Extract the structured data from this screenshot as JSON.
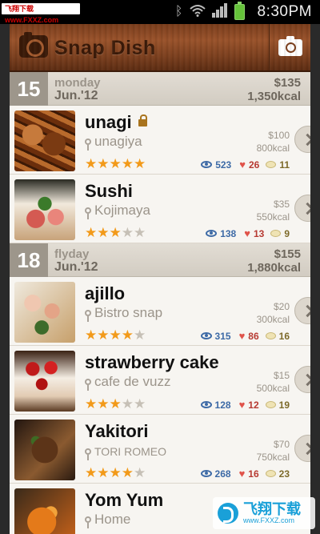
{
  "status_bar": {
    "watermark": "飞翔下载 www.FXXZ.com",
    "time": "8:30PM",
    "icons": [
      "bluetooth-icon",
      "wifi-icon",
      "signal-icon",
      "battery-icon"
    ]
  },
  "header": {
    "app_name": "Snap Dish",
    "camera_button": "camera-icon"
  },
  "days": [
    {
      "num": "15",
      "weekday": "monday",
      "date": "Jun.'12",
      "total_price": "$135",
      "total_kcal": "1,350kcal",
      "items": [
        {
          "title": "unagi",
          "locked": true,
          "place": "unagiya",
          "price": "$100",
          "kcal": "800kcal",
          "rating": 5,
          "views": "523",
          "likes": "26",
          "comments": "11"
        },
        {
          "title": "Sushi",
          "locked": false,
          "place": "Kojimaya",
          "price": "$35",
          "kcal": "550kcal",
          "rating": 3,
          "views": "138",
          "likes": "13",
          "comments": "9"
        }
      ]
    },
    {
      "num": "18",
      "weekday": "flyday",
      "date": "Jun.'12",
      "total_price": "$155",
      "total_kcal": "1,880kcal",
      "items": [
        {
          "title": "ajillo",
          "locked": false,
          "place": "Bistro snap",
          "price": "$20",
          "kcal": "300kcal",
          "rating": 4,
          "views": "315",
          "likes": "86",
          "comments": "16"
        },
        {
          "title": "strawberry cake",
          "locked": false,
          "place": "cafe de vuzz",
          "price": "$15",
          "kcal": "500kcal",
          "rating": 3,
          "views": "128",
          "likes": "12",
          "comments": "19"
        },
        {
          "title": "Yakitori",
          "locked": false,
          "place": "TORI ROMEO",
          "price": "$70",
          "kcal": "750kcal",
          "rating": 4,
          "views": "268",
          "likes": "16",
          "comments": "23"
        },
        {
          "title": "Yom Yum",
          "locked": false,
          "place": "Home",
          "price": "",
          "kcal": "",
          "rating": 0,
          "views": "",
          "likes": "",
          "comments": ""
        }
      ]
    }
  ],
  "watermark_bottom": {
    "line1": "飞翔下载",
    "line2": "www.FXXZ.com"
  }
}
